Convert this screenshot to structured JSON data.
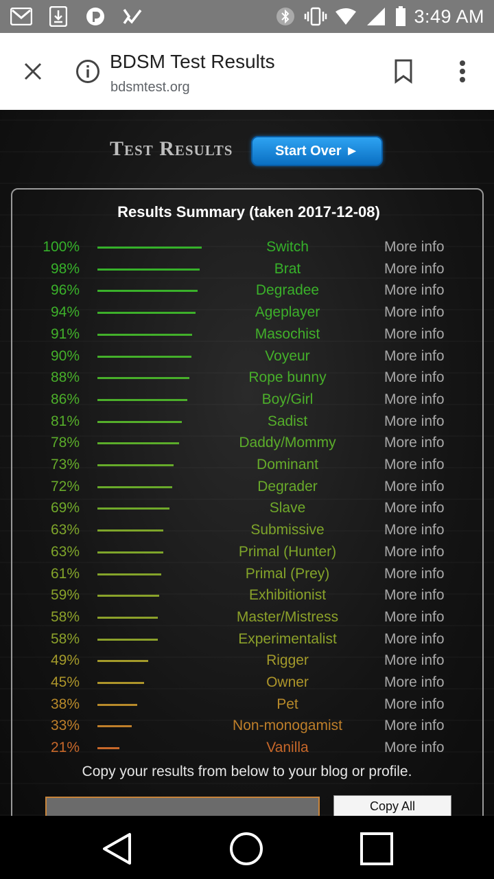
{
  "status_bar": {
    "time": "3:49 AM",
    "left_icons": [
      "gmail-icon",
      "download-icon",
      "pandora-icon",
      "task-check-icon"
    ],
    "right_icons": [
      "bluetooth-icon",
      "vibrate-icon",
      "wifi-icon",
      "signal-icon",
      "battery-icon"
    ]
  },
  "toolbar": {
    "title": "BDSM Test Results",
    "url": "bdsmtest.org"
  },
  "header": {
    "heading": "Test Results",
    "start_over": "Start Over ►"
  },
  "summary": {
    "title": "Results Summary (taken 2017-12-08)",
    "more_label": "More info",
    "rows": [
      {
        "pct": "100%",
        "value": 100,
        "label": "Switch",
        "color": "#35b12a"
      },
      {
        "pct": "98%",
        "value": 98,
        "label": "Brat",
        "color": "#37b22a"
      },
      {
        "pct": "96%",
        "value": 96,
        "label": "Degradee",
        "color": "#3ab12a"
      },
      {
        "pct": "94%",
        "value": 94,
        "label": "Ageplayer",
        "color": "#3db02a"
      },
      {
        "pct": "91%",
        "value": 91,
        "label": "Masochist",
        "color": "#42b02a"
      },
      {
        "pct": "90%",
        "value": 90,
        "label": "Voyeur",
        "color": "#44b02a"
      },
      {
        "pct": "88%",
        "value": 88,
        "label": "Rope bunny",
        "color": "#48af2a"
      },
      {
        "pct": "86%",
        "value": 86,
        "label": "Boy/Girl",
        "color": "#4caf2a"
      },
      {
        "pct": "81%",
        "value": 81,
        "label": "Sadist",
        "color": "#55ae2a"
      },
      {
        "pct": "78%",
        "value": 78,
        "label": "Daddy/Mommy",
        "color": "#5bad2a"
      },
      {
        "pct": "73%",
        "value": 73,
        "label": "Dominant",
        "color": "#66ab2a"
      },
      {
        "pct": "72%",
        "value": 72,
        "label": "Degrader",
        "color": "#69aa2a"
      },
      {
        "pct": "69%",
        "value": 69,
        "label": "Slave",
        "color": "#70a92a"
      },
      {
        "pct": "63%",
        "value": 63,
        "label": "Submissive",
        "color": "#7ea52a"
      },
      {
        "pct": "63%",
        "value": 63,
        "label": "Primal (Hunter)",
        "color": "#7ea52a"
      },
      {
        "pct": "61%",
        "value": 61,
        "label": "Primal (Prey)",
        "color": "#84a42a"
      },
      {
        "pct": "59%",
        "value": 59,
        "label": "Exhibitionist",
        "color": "#89a22a"
      },
      {
        "pct": "58%",
        "value": 58,
        "label": "Master/Mistress",
        "color": "#8ca12a"
      },
      {
        "pct": "58%",
        "value": 58,
        "label": "Experimentalist",
        "color": "#8ca12a"
      },
      {
        "pct": "49%",
        "value": 49,
        "label": "Rigger",
        "color": "#a39a2a"
      },
      {
        "pct": "45%",
        "value": 45,
        "label": "Owner",
        "color": "#ad952a"
      },
      {
        "pct": "38%",
        "value": 38,
        "label": "Pet",
        "color": "#b88a2a"
      },
      {
        "pct": "33%",
        "value": 33,
        "label": "Non-monogamist",
        "color": "#bf7f2a"
      },
      {
        "pct": "21%",
        "value": 21,
        "label": "Vanilla",
        "color": "#c8682a"
      }
    ]
  },
  "copy": {
    "text": "Copy your results from below to your blog or profile.",
    "button": "Copy All"
  },
  "nav": [
    "back-icon",
    "home-icon",
    "recents-icon"
  ]
}
